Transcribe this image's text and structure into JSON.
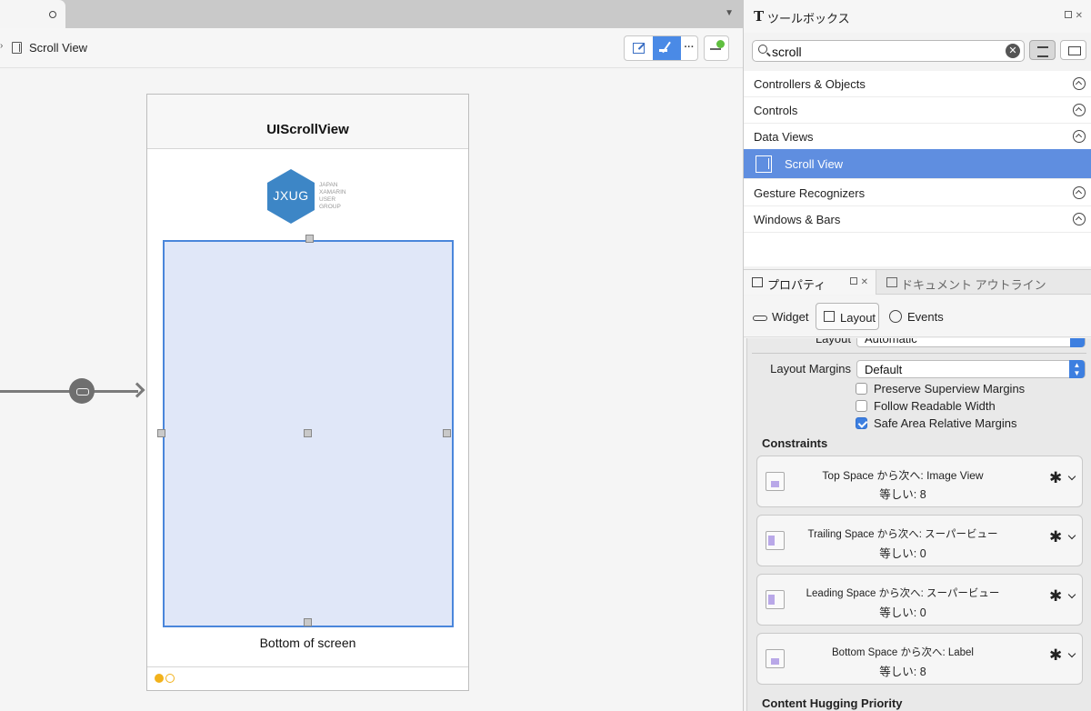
{
  "editor": {
    "breadcrumb_label": "Scroll View",
    "tab_menu_glyph": "▼",
    "more_glyph": "···"
  },
  "scene": {
    "nav_title": "UIScrollView",
    "logo_text": "JXUG",
    "logo_side_text": "JAPAN XAMARIN USER GROUP",
    "bottom_label": "Bottom of screen"
  },
  "toolbox": {
    "title": "ツールボックス",
    "search_value": "scroll",
    "clear_glyph": "✕",
    "items": [
      {
        "label": "Controllers & Objects",
        "selected": false
      },
      {
        "label": "Controls",
        "selected": false
      },
      {
        "label": "Data Views",
        "selected": false
      },
      {
        "label": "Scroll View",
        "selected": true
      },
      {
        "label": "Gesture Recognizers",
        "selected": false
      },
      {
        "label": "Windows & Bars",
        "selected": false
      }
    ]
  },
  "properties": {
    "tab_properties": "プロパティ",
    "tab_outline": "ドキュメント アウトライン",
    "subtabs": {
      "widget": "Widget",
      "layout": "Layout",
      "events": "Events"
    },
    "layout_label": "Layout",
    "layout_value": "Automatic",
    "layout_margins_label": "Layout Margins",
    "layout_margins_value": "Default",
    "checkboxes": [
      {
        "label": "Preserve Superview Margins",
        "checked": false
      },
      {
        "label": "Follow Readable Width",
        "checked": false
      },
      {
        "label": "Safe Area Relative Margins",
        "checked": true
      }
    ],
    "constraints_header": "Constraints",
    "constraints": [
      {
        "line1": "Top Space から次へ: Image View",
        "line2": "等しい: 8"
      },
      {
        "line1": "Trailing Space から次へ: スーパービュー",
        "line2": "等しい: 0"
      },
      {
        "line1": "Leading Space から次へ: スーパービュー",
        "line2": "等しい: 0"
      },
      {
        "line1": "Bottom Space から次へ: Label",
        "line2": "等しい: 8"
      }
    ],
    "hugging_header": "Content Hugging Priority"
  },
  "colors": {
    "selection": "#5f8ee0",
    "accent": "#3d7fe0",
    "scrollview_fill": "#e0e7f8",
    "scrollview_border": "#4a86db",
    "logo": "#3d86c6"
  }
}
